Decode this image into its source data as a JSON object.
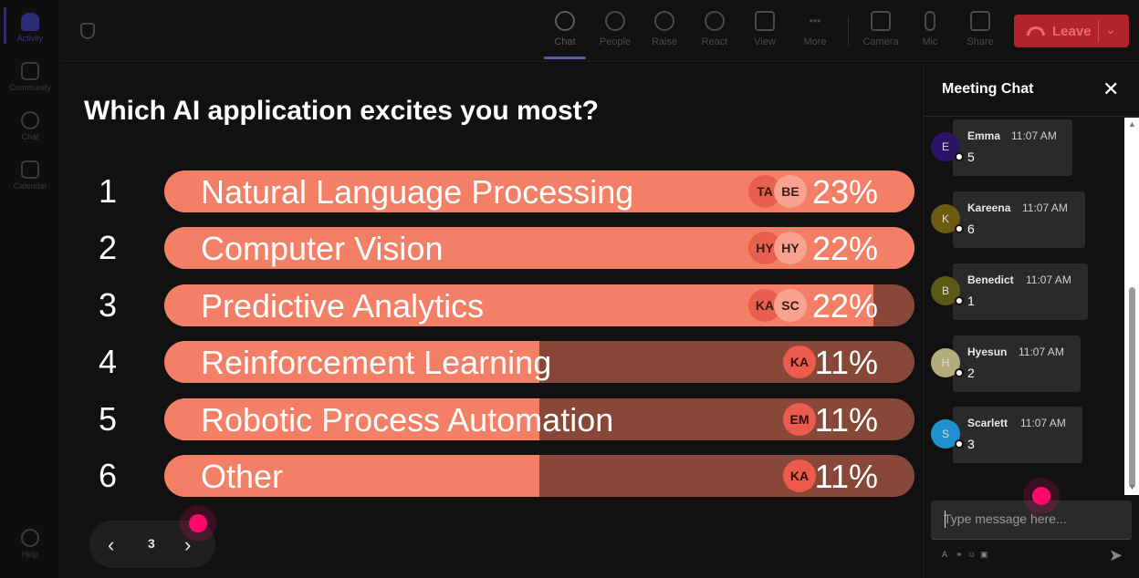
{
  "rail": {
    "items": [
      {
        "label": "Activity"
      },
      {
        "label": "Community"
      },
      {
        "label": "Chat"
      },
      {
        "label": "Calendar"
      },
      {
        "label": "Help"
      }
    ]
  },
  "toolbar": {
    "items": [
      {
        "label": "Chat",
        "icon": "chat-icon"
      },
      {
        "label": "People",
        "icon": "people-icon"
      },
      {
        "label": "Raise",
        "icon": "raise-hand-icon"
      },
      {
        "label": "React",
        "icon": "react-icon"
      },
      {
        "label": "View",
        "icon": "view-icon"
      },
      {
        "label": "More",
        "icon": "more-icon"
      },
      {
        "label": "Camera",
        "icon": "camera-off-icon"
      },
      {
        "label": "Mic",
        "icon": "mic-icon"
      },
      {
        "label": "Share",
        "icon": "share-icon"
      }
    ],
    "leave_label": "Leave"
  },
  "poll": {
    "question": "Which AI application excites you most?",
    "options": [
      {
        "rank": "1",
        "label": "Natural Language Processing",
        "percent": "23%",
        "fill": 1.0,
        "avatars": [
          "TA",
          "BE"
        ]
      },
      {
        "rank": "2",
        "label": "Computer Vision",
        "percent": "22%",
        "fill": 1.0,
        "avatars": [
          "HY",
          "HY"
        ]
      },
      {
        "rank": "3",
        "label": "Predictive Analytics",
        "percent": "22%",
        "fill": 0.945,
        "avatars": [
          "KA",
          "SC"
        ]
      },
      {
        "rank": "4",
        "label": "Reinforcement Learning",
        "percent": "11%",
        "fill": 0.5,
        "avatars": [
          "KA"
        ]
      },
      {
        "rank": "5",
        "label": "Robotic Process Automation",
        "percent": "11%",
        "fill": 0.5,
        "avatars": [
          "EM"
        ]
      },
      {
        "rank": "6",
        "label": "Other",
        "percent": "11%",
        "fill": 0.5,
        "avatars": [
          "KA"
        ]
      }
    ],
    "page": "3"
  },
  "chat": {
    "title": "Meeting Chat",
    "placeholder": "Type message here...",
    "messages": [
      {
        "initial": "E",
        "name": "Emma",
        "time": "11:07 AM",
        "text": "5",
        "color": "#2b1466"
      },
      {
        "initial": "K",
        "name": "Kareena",
        "time": "11:07 AM",
        "text": "6",
        "color": "#6a5a12"
      },
      {
        "initial": "B",
        "name": "Benedict",
        "time": "11:07 AM",
        "text": "1",
        "color": "#5a5a16"
      },
      {
        "initial": "H",
        "name": "Hyesun",
        "time": "11:07 AM",
        "text": "2",
        "color": "#b3ad7c"
      },
      {
        "initial": "S",
        "name": "Scarlett",
        "time": "11:07 AM",
        "text": "3",
        "color": "#1f8fd0"
      }
    ]
  },
  "colors": {
    "bar_fill": "#f27f66",
    "bar_track": "#874839",
    "leave": "#b5232a",
    "cursor": "#ff0a6c"
  }
}
